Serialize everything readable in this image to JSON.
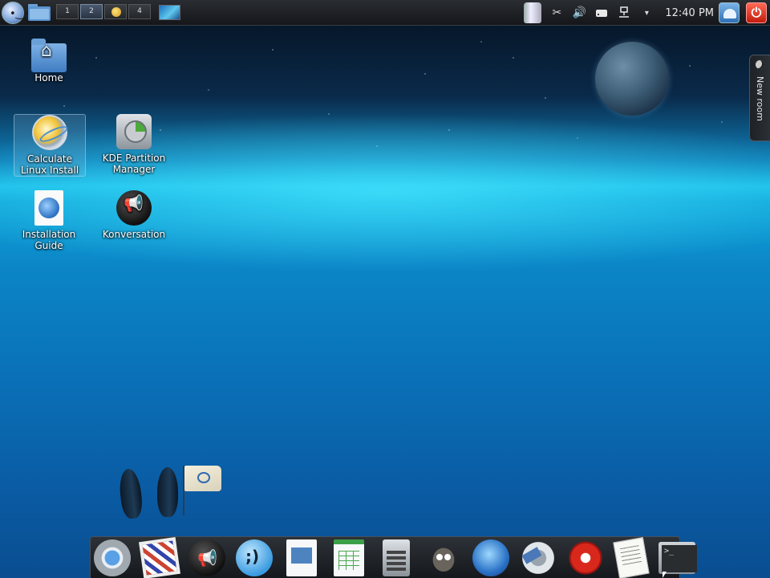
{
  "panel": {
    "pager": [
      "1",
      "2",
      "",
      "4"
    ],
    "clock": "12:40 PM",
    "icons": [
      "launcher-icon",
      "folder-icon",
      "trash-icon",
      "scissors-icon",
      "volume-icon",
      "drive-icon",
      "network-icon",
      "dropdown-icon",
      "lock-screen-icon",
      "power-icon"
    ]
  },
  "desktop": {
    "icons": [
      {
        "label": "Home"
      },
      {
        "label": "Calculate Linux Install"
      },
      {
        "label": "KDE Partition Manager"
      },
      {
        "label": "Installation Guide"
      },
      {
        "label": "Konversation"
      }
    ],
    "activity_tab": "New room"
  },
  "dock": {
    "apps": [
      "chromium",
      "mail",
      "konversation",
      "kopete",
      "writer",
      "spreadsheet",
      "calculator",
      "gimp",
      "firefox",
      "smplayer",
      "media",
      "kwrite",
      "terminal"
    ]
  }
}
